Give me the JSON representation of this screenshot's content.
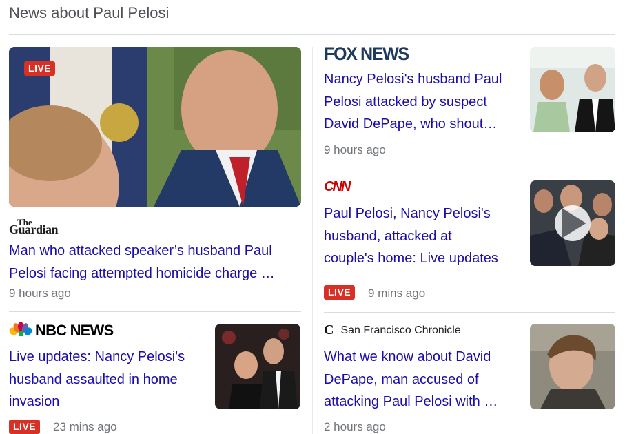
{
  "section": {
    "title": "News about Paul Pelosi"
  },
  "articles": [
    {
      "source": "The Guardian",
      "source_logo_top": "The",
      "source_logo_bottom": "Guardian",
      "headline_line1": "Man who attacked speaker’s husband Paul",
      "headline_line2": "Pelosi facing attempted homicide charge …",
      "time": "9 hours ago",
      "live_label": "LIVE"
    },
    {
      "source": "FOX NEWS",
      "headline_line1": "Nancy Pelosi's husband Paul",
      "headline_line2": "Pelosi attacked by suspect",
      "headline_line3": "David DePape, who shout…",
      "time": "9 hours ago"
    },
    {
      "source": "CNN",
      "headline_line1": "Paul Pelosi, Nancy Pelosi's",
      "headline_line2": "husband, attacked at",
      "headline_line3": "couple's home: Live updates",
      "time": "9 mins ago",
      "live_label": "LIVE"
    },
    {
      "source": "NBC NEWS",
      "headline_line1": "Live updates: Nancy Pelosi's",
      "headline_line2": "husband assaulted in home",
      "headline_line3": "invasion",
      "time": "23 mins ago",
      "live_label": "LIVE"
    },
    {
      "source": "San Francisco Chronicle",
      "source_mark": "C",
      "headline_line1": "What we know about David",
      "headline_line2": "DePape, man accused of",
      "headline_line3": "attacking Paul Pelosi with …",
      "time": "2 hours ago"
    }
  ],
  "colors": {
    "link": "#1a0dab",
    "live": "#d93025",
    "meta": "#70757a"
  },
  "icons": {
    "video": "play-icon",
    "nbc": "peacock-icon"
  }
}
